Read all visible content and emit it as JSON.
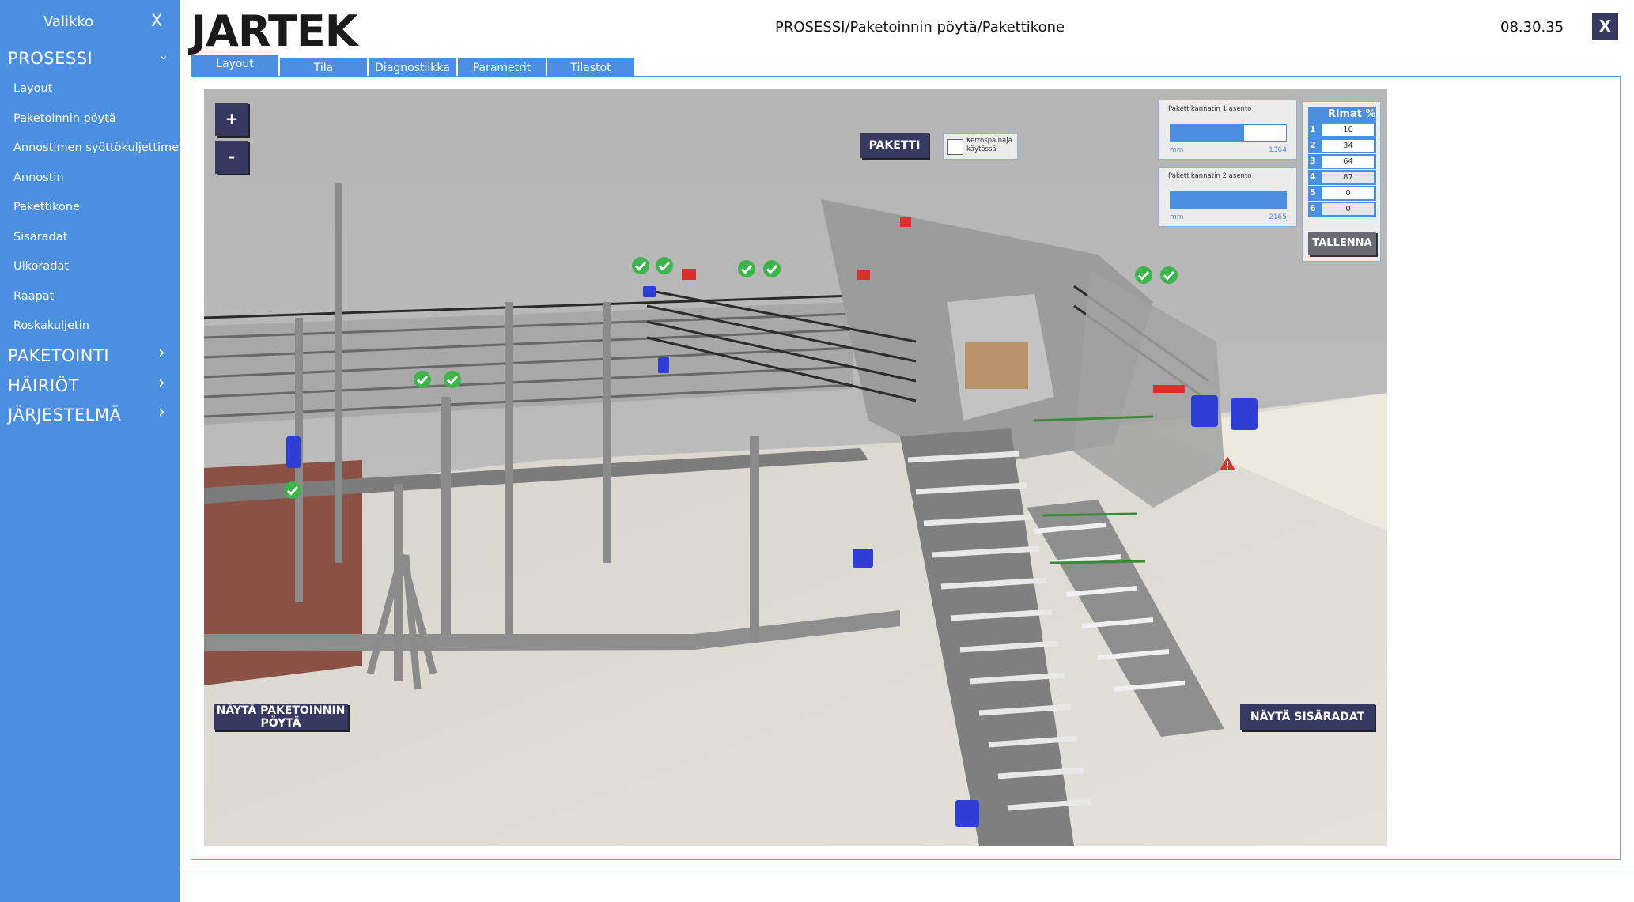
{
  "sidebar": {
    "title": "Valikko",
    "close_label": "X",
    "section_prosessi": {
      "label": "PROSESSI",
      "chevron": "⌄"
    },
    "items": [
      {
        "label": "Layout"
      },
      {
        "label": "Paketoinnin pöytä"
      },
      {
        "label": "Annostimen syöttökuljettimet"
      },
      {
        "label": "Annostin"
      },
      {
        "label": "Pakettikone"
      },
      {
        "label": "Sisäradat"
      },
      {
        "label": "Ulkoradat"
      },
      {
        "label": "Raapat"
      },
      {
        "label": "Roskakuljetin"
      }
    ],
    "sections": [
      {
        "label": "PAKETOINTI",
        "chevron": "›"
      },
      {
        "label": "HÄIRIÖT",
        "chevron": "›"
      },
      {
        "label": "JÄRJESTELMÄ",
        "chevron": "›"
      }
    ]
  },
  "header": {
    "logo": "JARTEK",
    "breadcrumb": "PROSESSI/Paketoinnin pöytä/Pakettikone",
    "clock": "08.30.35",
    "close_label": "X"
  },
  "tabs": [
    {
      "label": "Layout",
      "active": true
    },
    {
      "label": "Tila",
      "active": false
    },
    {
      "label": "Diagnostiikka",
      "active": false
    },
    {
      "label": "Parametrit",
      "active": false
    },
    {
      "label": "Tilastot",
      "active": false
    }
  ],
  "viewport": {
    "zoom_in": "+",
    "zoom_out": "-",
    "paketti_button": "PAKETTI",
    "kerros_label_1": "Kerrospainaja",
    "kerros_label_2": "käytössä",
    "kerros_checked": false,
    "position_1": {
      "title": "Pakettikannatin 1 asento",
      "unit": "mm",
      "value": "1364",
      "fill_fraction": 0.64
    },
    "position_2": {
      "title": "Pakettikannatin 2 asento",
      "unit": "mm",
      "value": "2165",
      "fill_fraction": 1.0
    },
    "rimat": {
      "title": "Rimat %",
      "rows": [
        {
          "n": "1",
          "value": "10"
        },
        {
          "n": "2",
          "value": "34"
        },
        {
          "n": "3",
          "value": "64"
        },
        {
          "n": "4",
          "value": "87"
        },
        {
          "n": "5",
          "value": "0"
        },
        {
          "n": "6",
          "value": "0"
        }
      ],
      "save_label": "TALLENNA"
    },
    "show_table_button_line1": "NÄYTÄ PAKETOINNIN",
    "show_table_button_line2": "PÖYTÄ",
    "show_inner_button": "NÄYTÄ SISÄRADAT",
    "status_icons": [
      "check-ok-icon",
      "warning-icon"
    ]
  },
  "colors": {
    "sidebar_bg": "#4a8fe0",
    "button_bg": "#373a60",
    "ok_green": "#3cb54a",
    "warning_red": "#d93030",
    "motor_blue": "#2f3fd6"
  }
}
